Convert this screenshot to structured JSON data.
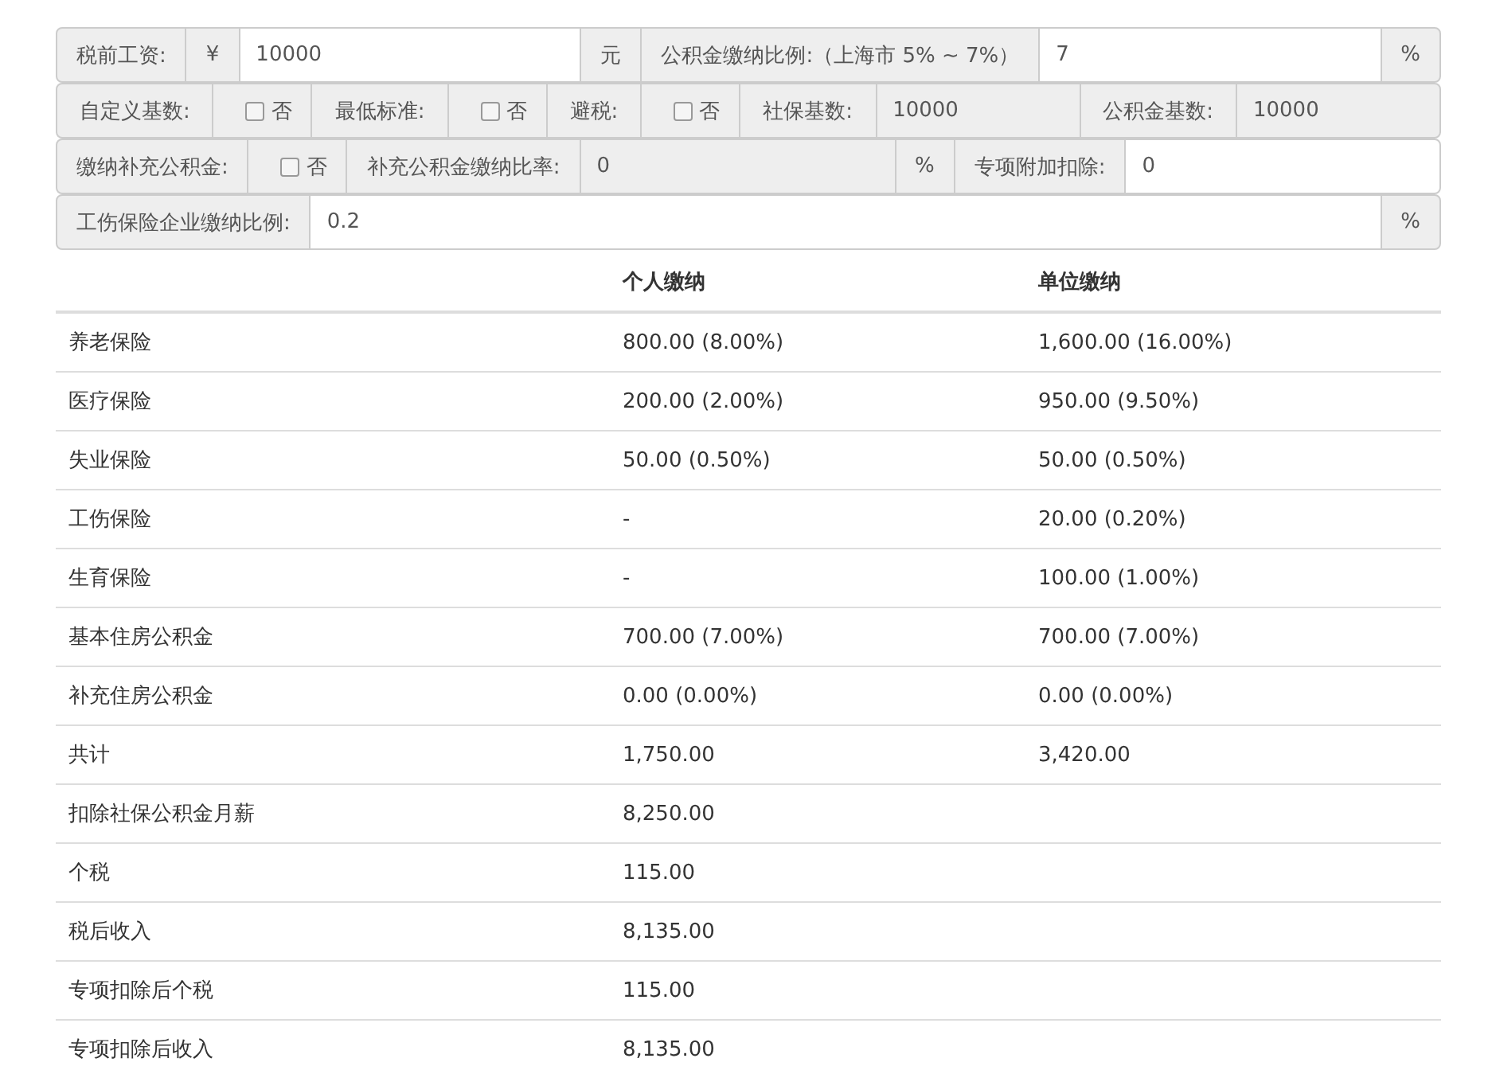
{
  "form_rows": [
    [
      {
        "kind": "addon",
        "text": "税前工资:"
      },
      {
        "kind": "addon",
        "text": "¥"
      },
      {
        "kind": "input",
        "value": "10000"
      },
      {
        "kind": "addon",
        "text": "元"
      },
      {
        "kind": "addon",
        "text": "公积金缴纳比例:（上海市 5% ~ 7%）"
      },
      {
        "kind": "input",
        "value": "7"
      },
      {
        "kind": "addon",
        "text": "%"
      }
    ],
    [
      {
        "kind": "addon",
        "text": "自定义基数:"
      },
      {
        "kind": "check",
        "text": "否",
        "checked": false
      },
      {
        "kind": "addon",
        "text": "最低标准:"
      },
      {
        "kind": "check",
        "text": "否",
        "checked": false
      },
      {
        "kind": "addon",
        "text": "避税:"
      },
      {
        "kind": "check",
        "text": "否",
        "checked": false
      },
      {
        "kind": "addon",
        "text": "社保基数:"
      },
      {
        "kind": "readonly",
        "value": "10000"
      },
      {
        "kind": "addon",
        "text": "公积金基数:"
      },
      {
        "kind": "readonly",
        "value": "10000"
      }
    ],
    [
      {
        "kind": "addon",
        "text": "缴纳补充公积金:"
      },
      {
        "kind": "check",
        "text": "否",
        "checked": false
      },
      {
        "kind": "addon",
        "text": "补充公积金缴纳比率:"
      },
      {
        "kind": "readonly",
        "value": "0"
      },
      {
        "kind": "addon",
        "text": "%"
      },
      {
        "kind": "addon",
        "text": "专项附加扣除:"
      },
      {
        "kind": "input",
        "value": "0"
      }
    ],
    [
      {
        "kind": "addon",
        "text": "工伤保险企业缴纳比例:"
      },
      {
        "kind": "input",
        "value": "0.2"
      },
      {
        "kind": "addon",
        "text": "%"
      }
    ]
  ],
  "table": {
    "columns": [
      "",
      "个人缴纳",
      "单位缴纳"
    ],
    "rows": [
      [
        "养老保险",
        "800.00 (8.00%)",
        "1,600.00 (16.00%)"
      ],
      [
        "医疗保险",
        "200.00 (2.00%)",
        "950.00 (9.50%)"
      ],
      [
        "失业保险",
        "50.00 (0.50%)",
        "50.00 (0.50%)"
      ],
      [
        "工伤保险",
        "-",
        "20.00 (0.20%)"
      ],
      [
        "生育保险",
        "-",
        "100.00 (1.00%)"
      ],
      [
        "基本住房公积金",
        "700.00 (7.00%)",
        "700.00 (7.00%)"
      ],
      [
        "补充住房公积金",
        "0.00 (0.00%)",
        "0.00 (0.00%)"
      ],
      [
        "共计",
        "1,750.00",
        "3,420.00"
      ],
      [
        "扣除社保公积金月薪",
        "8,250.00",
        ""
      ],
      [
        "个税",
        "115.00",
        ""
      ],
      [
        "税后收入",
        "8,135.00",
        ""
      ],
      [
        "专项扣除后个税",
        "115.00",
        ""
      ],
      [
        "专项扣除后收入",
        "8,135.00",
        ""
      ]
    ]
  }
}
